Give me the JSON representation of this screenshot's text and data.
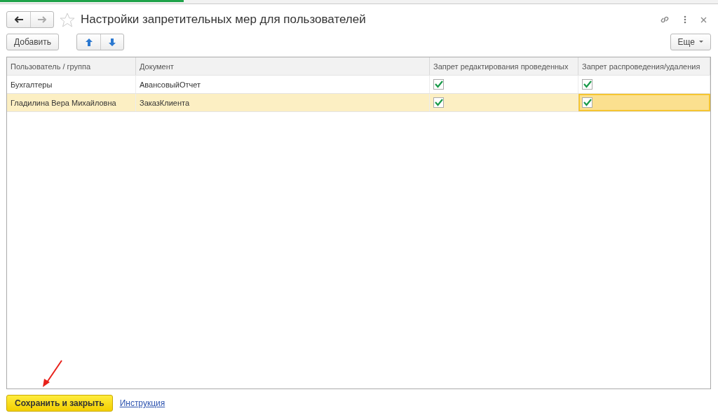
{
  "window": {
    "title": "Настройки запретительных мер для пользователей",
    "favorite": false
  },
  "toolbar": {
    "add": "Добавить",
    "more": "Еще"
  },
  "table": {
    "columns": [
      "Пользователь / группа",
      "Документ",
      "Запрет редактирования проведенных",
      "Запрет распроведения/удаления"
    ],
    "rows": [
      {
        "user": "Бухгалтеры",
        "document": "АвансовыйОтчет",
        "selected": false,
        "flags": [
          {
            "checked": true,
            "focused": false
          },
          {
            "checked": true,
            "focused": false
          }
        ]
      },
      {
        "user": "Гладилина Вера Михайловна",
        "document": "ЗаказКлиента",
        "selected": true,
        "flags": [
          {
            "checked": true,
            "focused": false
          },
          {
            "checked": true,
            "focused": true
          }
        ]
      }
    ]
  },
  "footer": {
    "save": "Сохранить и закрыть",
    "link": "Инструкция"
  }
}
